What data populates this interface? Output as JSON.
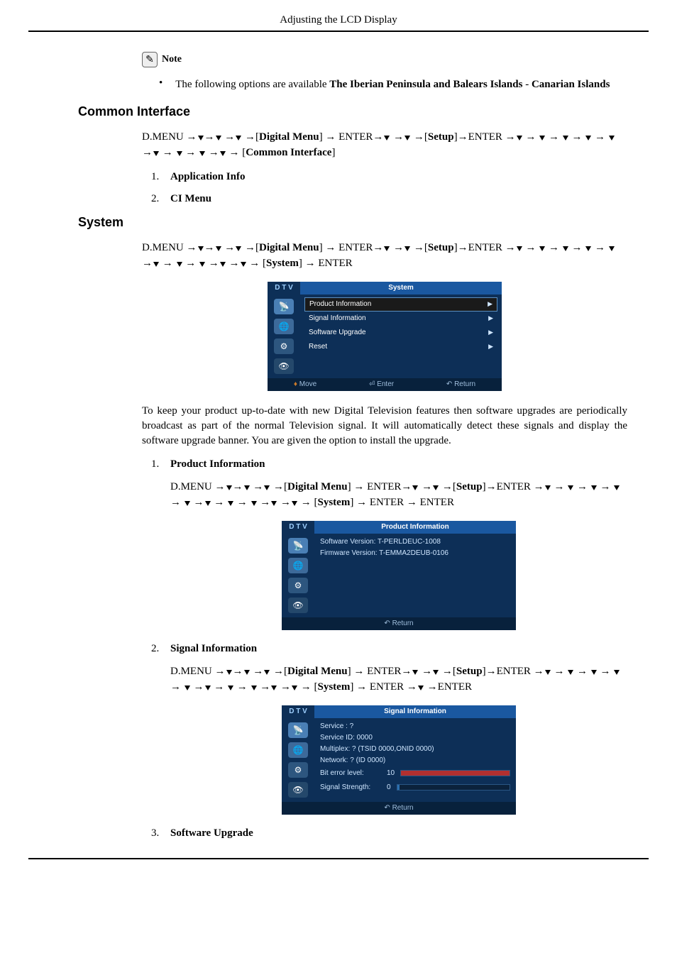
{
  "header": {
    "title": "Adjusting the LCD Display"
  },
  "note": {
    "label": "Note"
  },
  "bullet1": {
    "pre": "The following options are available ",
    "b1": "The Iberian Peninsula and Balears Islands",
    "sep": " - ",
    "b2": "Canarian Islands"
  },
  "sections": {
    "common_interface": "Common Interface",
    "system": "System"
  },
  "paths": {
    "p1_a": "D.MENU →",
    "p1_b": "→",
    "p1_c": " →",
    "p1_d": " →[",
    "p1_dm": "Digital Menu",
    "p1_e": "] → ENTER→",
    "p1_f": " →",
    "p1_g": " →[",
    "p1_su": "Setup",
    "p1_h": "]→ENTER →",
    "p1_i": " → ",
    "p1_j": " → ",
    "p1_k": " → ",
    "p1_l": " → ",
    "p1_m": " →",
    "p1_n": " → ",
    "p1_o": " → ",
    "p1_p": " →",
    "p1_q": " → [",
    "p1_ci": "Common Interface",
    "p1_r": "]",
    "p2_a": "D.MENU →",
    "p2_b": "→",
    "p2_c": " →",
    "p2_d": " →[",
    "p2_dm": "Digital Menu",
    "p2_e": "] → ENTER→",
    "p2_f": " →",
    "p2_g": " →[",
    "p2_su": "Setup",
    "p2_h": "]→ENTER →",
    "p2_i": " → ",
    "p2_j": " → ",
    "p2_k": " → ",
    "p2_l": " → ",
    "p2_m": " →",
    "p2_n": " → ",
    "p2_o": " → ",
    "p2_p": " →",
    "p2_pp": " →",
    "p2_q": " → [",
    "p2_sys": "System",
    "p2_r": "] → ENTER",
    "p3_q": " → [",
    "p3_sys": "System",
    "p3_r": "] → ENTER → ENTER",
    "p4_q": " → [",
    "p4_sys": "System",
    "p4_r": "] → ENTER →",
    "p4_s": " →ENTER"
  },
  "para_system": "To keep your product up-to-date with new Digital Television features then software upgrades are periodically broadcast as part of the normal Television signal. It will automatically detect these signals and display the software upgrade banner. You are given the option to install the upgrade.",
  "steps_ci": {
    "1": "Application Info",
    "2": "CI Menu"
  },
  "steps_sys": {
    "1": "Product Information",
    "2": "Signal Information",
    "3": "Software Upgrade"
  },
  "screens": {
    "system": {
      "tag": "D T V",
      "title": "System",
      "items": [
        "Product Information",
        "Signal Information",
        "Software Upgrade",
        "Reset"
      ],
      "footer": {
        "move": "Move",
        "enter": "Enter",
        "return": "Return"
      }
    },
    "product_info": {
      "tag": "D T V",
      "title": "Product Information",
      "l1": "Software Version: T-PERLDEUC-1008",
      "l2": "Firmware Version: T-EMMA2DEUB-0106",
      "return": "Return"
    },
    "signal_info": {
      "tag": "D T V",
      "title": "Signal Information",
      "l1": "Service : ?",
      "l2": "Service ID: 0000",
      "l3": "Multiplex: ? (TSID 0000,ONID 0000)",
      "l4": "Network: ? (ID 0000)",
      "bl1": "Bit error level:",
      "bl1v": "10",
      "bl2": "Signal Strength:",
      "bl2v": "0",
      "return": "Return"
    }
  }
}
